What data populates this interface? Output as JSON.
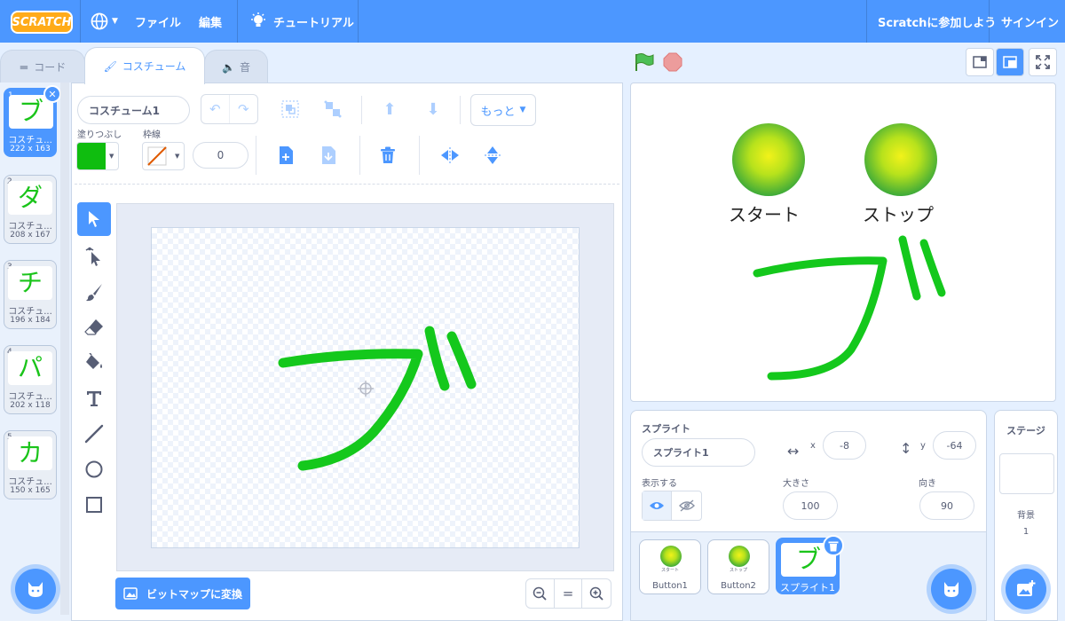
{
  "menubar": {
    "logo": "SCRATCH",
    "file": "ファイル",
    "edit": "編集",
    "tutorials": "チュートリアル",
    "join": "Scratchに参加しよう",
    "signin": "サインイン"
  },
  "tabs": {
    "code": "コード",
    "costumes": "コスチューム",
    "sounds": "音"
  },
  "costumes": [
    {
      "num": "1",
      "glyph": "ブ",
      "name": "コスチュ...",
      "size": "222 x 163"
    },
    {
      "num": "2",
      "glyph": "ダ",
      "name": "コスチュ...",
      "size": "208 x 167"
    },
    {
      "num": "3",
      "glyph": "チ",
      "name": "コスチュ...",
      "size": "196 x 184"
    },
    {
      "num": "4",
      "glyph": "パ",
      "name": "コスチュ...",
      "size": "202 x 118"
    },
    {
      "num": "5",
      "glyph": "カ",
      "name": "コスチュ...",
      "size": "150 x 165"
    }
  ],
  "editor": {
    "costume_name": "コスチューム1",
    "more": "もっと",
    "fill_label": "塗りつぶし",
    "outline_label": "枠線",
    "outline_width": "0",
    "fill_color": "#0fbd0f",
    "convert_bitmap": "ビットマップに変換"
  },
  "stage": {
    "start_label": "スタート",
    "stop_label": "ストップ"
  },
  "sprite_info": {
    "title": "スプライト",
    "sprite_name": "スプライト1",
    "x_label": "x",
    "x_value": "-8",
    "y_label": "y",
    "y_value": "-64",
    "show_label": "表示する",
    "size_label": "大きさ",
    "size_value": "100",
    "direction_label": "向き",
    "direction_value": "90"
  },
  "sprites": [
    {
      "name": "Button1",
      "caption": "スタート"
    },
    {
      "name": "Button2",
      "caption": "ストップ"
    },
    {
      "name": "スプライト1",
      "glyph": "ブ"
    }
  ],
  "stage_panel": {
    "title": "ステージ",
    "backdrops_label": "背景",
    "backdrops_count": "1"
  }
}
